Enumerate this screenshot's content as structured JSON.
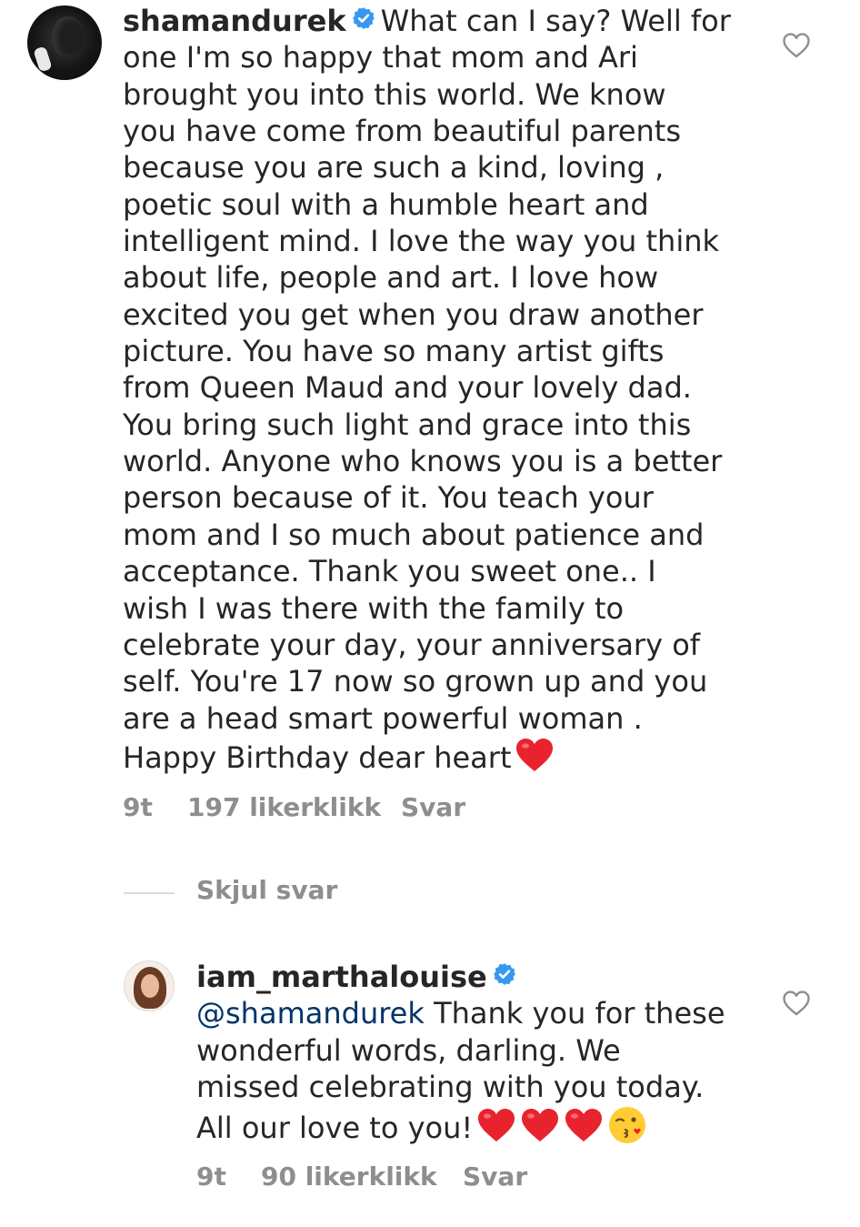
{
  "colors": {
    "text": "#262626",
    "muted": "#8e8e8e",
    "verified_blue": "#3897f0",
    "mention": "#003569",
    "heart_red": "#e8232d"
  },
  "comments": [
    {
      "username": "shamandurek",
      "verified": true,
      "avatar_icon": "profile-photo",
      "text_lines": [
        "What can I say? Well for",
        "one I'm so happy that mom and Ari",
        "brought you into this world. We know",
        "you have come from beautiful parents",
        "because you are such a kind, loving ,",
        "poetic soul with a humble heart and",
        "intelligent mind. I love the way you think",
        "about life, people and art. I love how",
        "excited you get when you draw another",
        "picture. You have so many artist gifts",
        "from Queen Maud and your lovely dad.",
        "You bring such light and grace into this",
        "world. Anyone who knows you is a better",
        "person because of it. You teach your",
        "mom and I so much about patience and",
        "acceptance. Thank you sweet one.. I",
        "wish I was there with the family to",
        "celebrate your day, your anniversary of",
        "self. You're 17 now so grown up and you",
        "are a head smart powerful woman .",
        "Happy Birthday dear heart"
      ],
      "emojis": [
        "red-heart"
      ],
      "time": "9t",
      "likes": "197 likerklikk",
      "reply": "Svar"
    },
    {
      "username": "iam_marthalouise",
      "verified": true,
      "avatar_icon": "profile-photo",
      "mention": "@shamandurek",
      "text_lines": [
        "Thank you for these",
        "wonderful words, darling. We",
        "missed celebrating with you today.",
        "All our love to you!"
      ],
      "emojis": [
        "red-heart",
        "red-heart",
        "red-heart",
        "kissing-face"
      ],
      "time": "9t",
      "likes": "90 likerklikk",
      "reply": "Svar"
    }
  ],
  "hide_replies": "Skjul svar",
  "icons": {
    "like": "heart-outline-icon",
    "verified": "verified-badge-icon"
  }
}
